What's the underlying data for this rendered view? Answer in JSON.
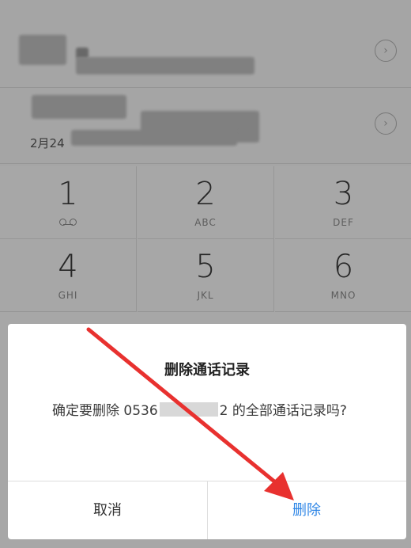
{
  "call_log": {
    "row2_date": "2月24"
  },
  "keypad": {
    "keys": [
      {
        "digit": "1",
        "letters": ""
      },
      {
        "digit": "2",
        "letters": "ABC"
      },
      {
        "digit": "3",
        "letters": "DEF"
      },
      {
        "digit": "4",
        "letters": "GHI"
      },
      {
        "digit": "5",
        "letters": "JKL"
      },
      {
        "digit": "6",
        "letters": "MNO"
      }
    ]
  },
  "dialog": {
    "title": "删除通话记录",
    "message_prefix": "确定要删除 0536",
    "message_suffix": "2 的全部通话记录吗?",
    "cancel_label": "取消",
    "confirm_label": "删除"
  },
  "colors": {
    "accent": "#2f86e6",
    "annotation": "#e8312f"
  }
}
